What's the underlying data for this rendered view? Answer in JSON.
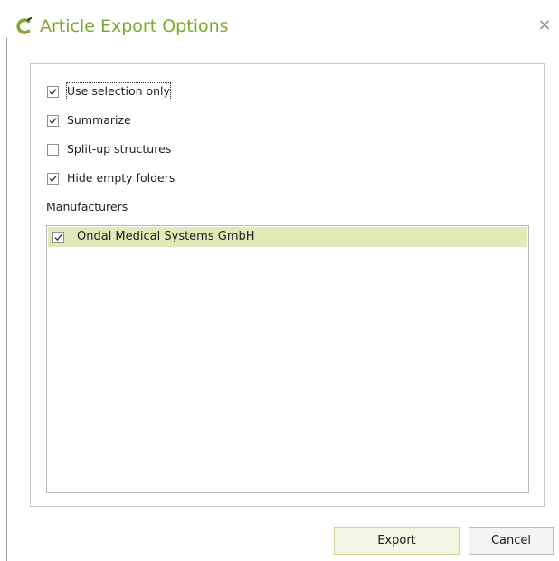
{
  "dialog": {
    "title": "Article Export Options",
    "close_symbol": "×",
    "brand_color": "#7fa830",
    "logo_icon": "logo-c-icon"
  },
  "options": [
    {
      "label": "Use selection only",
      "checked": true,
      "focused": true
    },
    {
      "label": "Summarize",
      "checked": true
    },
    {
      "label": "Split-up structures",
      "checked": false
    },
    {
      "label": "Hide empty folders",
      "checked": true
    }
  ],
  "manufacturers": {
    "label": "Manufacturers",
    "items": [
      {
        "name": "Ondal Medical Systems GmbH",
        "checked": true,
        "selected": true
      }
    ]
  },
  "buttons": {
    "export": "Export",
    "cancel": "Cancel"
  }
}
